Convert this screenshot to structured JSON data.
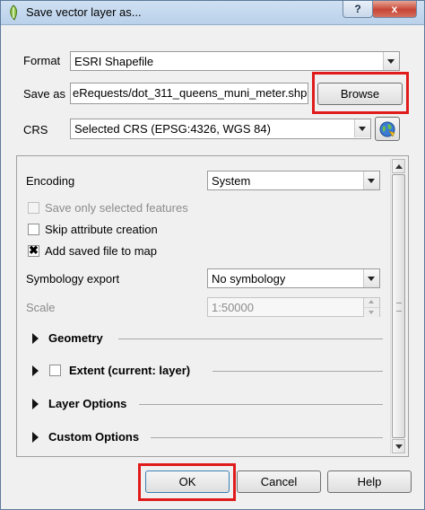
{
  "window": {
    "title": "Save vector layer as..."
  },
  "titlebar": {
    "help_label": "?",
    "close_label": "x"
  },
  "form": {
    "format_label": "Format",
    "format_value": "ESRI Shapefile",
    "save_as_label": "Save as",
    "save_as_value": "eRequests/dot_311_queens_muni_meter.shp",
    "browse_label": "Browse",
    "crs_label": "CRS",
    "crs_value": "Selected CRS (EPSG:4326, WGS 84)"
  },
  "options": {
    "encoding_label": "Encoding",
    "encoding_value": "System",
    "save_selected_label": "Save only selected features",
    "save_selected_checked": false,
    "skip_attr_label": "Skip attribute creation",
    "skip_attr_checked": false,
    "add_map_label": "Add saved file to map",
    "add_map_checked": true,
    "add_map_mark": "✖",
    "symbology_label": "Symbology export",
    "symbology_value": "No symbology",
    "scale_label": "Scale",
    "scale_value": "1:50000"
  },
  "sections": [
    {
      "label": "Geometry"
    },
    {
      "label": "Extent (current: layer)"
    },
    {
      "label": "Layer Options"
    },
    {
      "label": "Custom Options"
    }
  ],
  "footer": {
    "ok_label": "OK",
    "cancel_label": "Cancel",
    "help_label": "Help"
  },
  "colors": {
    "highlight": "#e01b1b",
    "titlebar": "#c3d7ee",
    "close": "#c74535"
  }
}
